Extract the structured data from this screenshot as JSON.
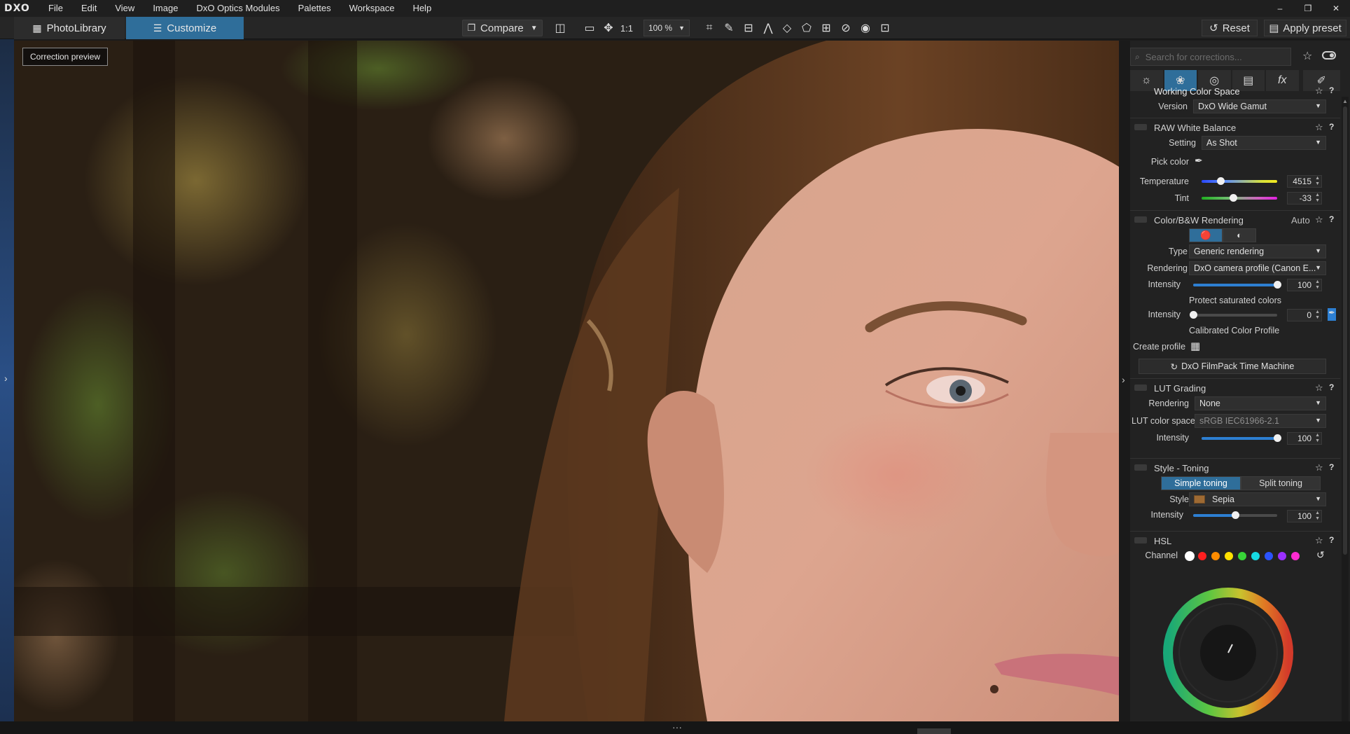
{
  "app": {
    "logo": "DXO"
  },
  "menu": [
    "File",
    "Edit",
    "View",
    "Image",
    "DxO Optics Modules",
    "Palettes",
    "Workspace",
    "Help"
  ],
  "window_controls": {
    "minimize": "–",
    "restore": "❐",
    "close": "✕"
  },
  "toolbar": {
    "tab_photolibrary": "PhotoLibrary",
    "tab_customize": "Customize",
    "compare": "Compare",
    "one_to_one": "1:1",
    "zoom": "100 %",
    "reset": "Reset",
    "apply_preset": "Apply preset"
  },
  "viewer": {
    "badge": "Correction preview"
  },
  "panel": {
    "search_placeholder": "Search for corrections...",
    "working_color_space": {
      "title": "Working Color Space",
      "version_label": "Version",
      "version_value": "DxO Wide Gamut"
    },
    "raw_white_balance": {
      "title": "RAW White Balance",
      "setting_label": "Setting",
      "setting_value": "As Shot",
      "pick_color_label": "Pick color",
      "temperature_label": "Temperature",
      "temperature_value": "4515",
      "temperature_position": 0.25,
      "tint_label": "Tint",
      "tint_value": "-33",
      "tint_position": 0.42
    },
    "color_rendering": {
      "title": "Color/B&W Rendering",
      "auto": "Auto",
      "type_label": "Type",
      "type_value": "Generic rendering",
      "rendering_label": "Rendering",
      "rendering_value": "DxO camera profile (Canon E...",
      "intensity_label": "Intensity",
      "intensity_value": "100",
      "intensity_position": 1.0,
      "protect_label": "Protect saturated colors",
      "protect_intensity_label": "Intensity",
      "protect_intensity_value": "0",
      "protect_intensity_position": 0.0,
      "calibrated_label": "Calibrated Color Profile",
      "create_profile_label": "Create profile",
      "filmpack_button": "DxO FilmPack Time Machine"
    },
    "lut_grading": {
      "title": "LUT Grading",
      "rendering_label": "Rendering",
      "rendering_value": "None",
      "colorspace_label": "LUT color space",
      "colorspace_value": "sRGB IEC61966-2.1",
      "intensity_label": "Intensity",
      "intensity_value": "100",
      "intensity_position": 1.0
    },
    "style_toning": {
      "title": "Style - Toning",
      "simple": "Simple toning",
      "split": "Split toning",
      "style_label": "Style",
      "style_value": "Sepia",
      "intensity_label": "Intensity",
      "intensity_value": "100",
      "intensity_position": 0.5
    },
    "hsl": {
      "title": "HSL",
      "channel_label": "Channel",
      "channels": [
        "#ffffff",
        "#ff1f1f",
        "#ff8c00",
        "#ffe000",
        "#38d438",
        "#16d9e3",
        "#2b53ff",
        "#9b30ff",
        "#ff2bd1"
      ]
    }
  },
  "colors": {
    "accent": "#2f6e9a",
    "slider_fill": "#2d7fd2"
  }
}
